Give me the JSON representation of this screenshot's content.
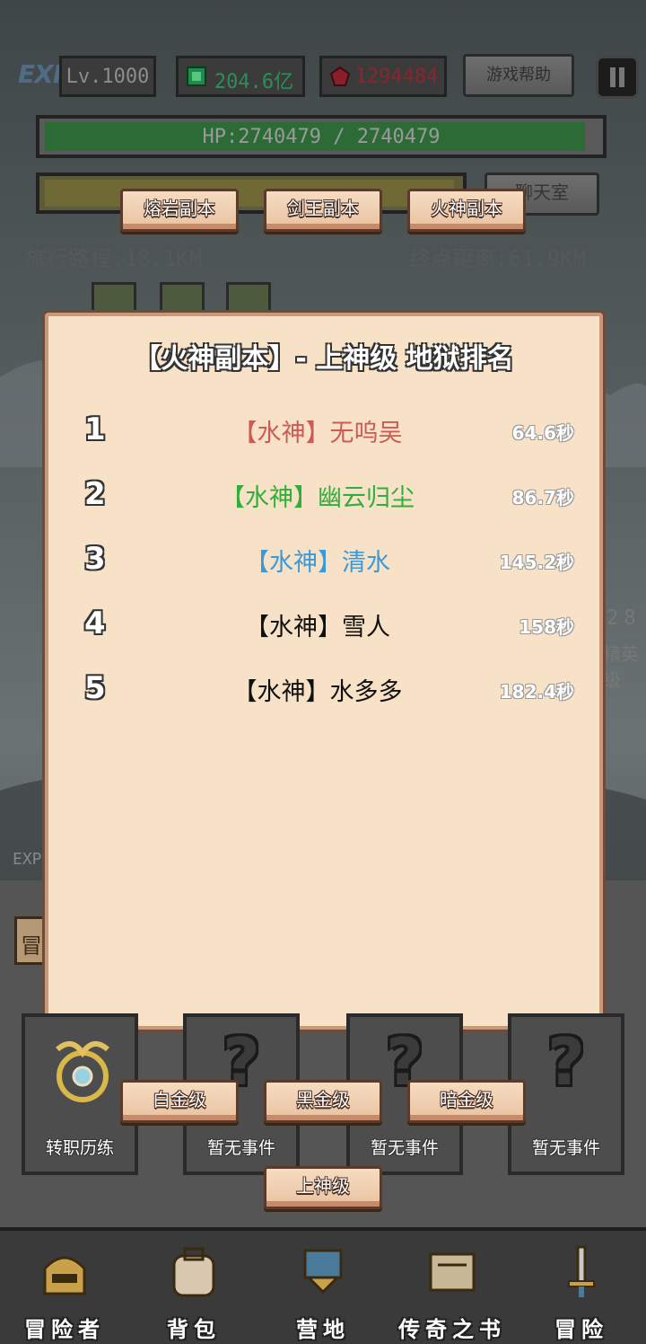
{
  "header": {
    "exp_logo": "EXP",
    "level": "Lv.1000",
    "gold": "204.6亿",
    "gems": "1294484",
    "help_button": "游戏帮助",
    "hp_text": "HP:2740479 / 2740479",
    "chat_button": "聊天室"
  },
  "journey": {
    "traveled": "旅行路程:18.1KM",
    "remaining": "终点距离:61.9KM"
  },
  "dungeon_tabs": [
    "熔岩副本",
    "剑王副本",
    "火神副本"
  ],
  "modal": {
    "title": "【火神副本】- 上神级 地狱排名",
    "rankings": [
      {
        "rank": "1",
        "name": "【水神】无呜吴",
        "time": "64.6秒",
        "color": "#cc5a55"
      },
      {
        "rank": "2",
        "name": "【水神】幽云归尘",
        "time": "86.7秒",
        "color": "#2fae3a"
      },
      {
        "rank": "3",
        "name": "【水神】清水",
        "time": "145.2秒",
        "color": "#3d98d8"
      },
      {
        "rank": "4",
        "name": "【水神】雪人",
        "time": "158秒",
        "color": "#111111"
      },
      {
        "rank": "5",
        "name": "【水神】水多多",
        "time": "182.4秒",
        "color": "#111111"
      }
    ]
  },
  "tier_buttons": [
    "白金级",
    "黑金级",
    "暗金级",
    "上神级"
  ],
  "event_cards": [
    "转职历练",
    "暂无事件",
    "暂无事件",
    "暂无事件"
  ],
  "bottom_nav": [
    "冒险者",
    "背包",
    "营地",
    "传奇之书",
    "冒险"
  ],
  "background_fragments": {
    "left_tab": "冒",
    "exp_small": "EXP",
    "right_number": "28",
    "right_label": "精英级"
  },
  "colors": {
    "hp_bar": "#2d8a3a",
    "wood_button": "#f0d0b0",
    "modal_bg": "#f8e2c7"
  }
}
